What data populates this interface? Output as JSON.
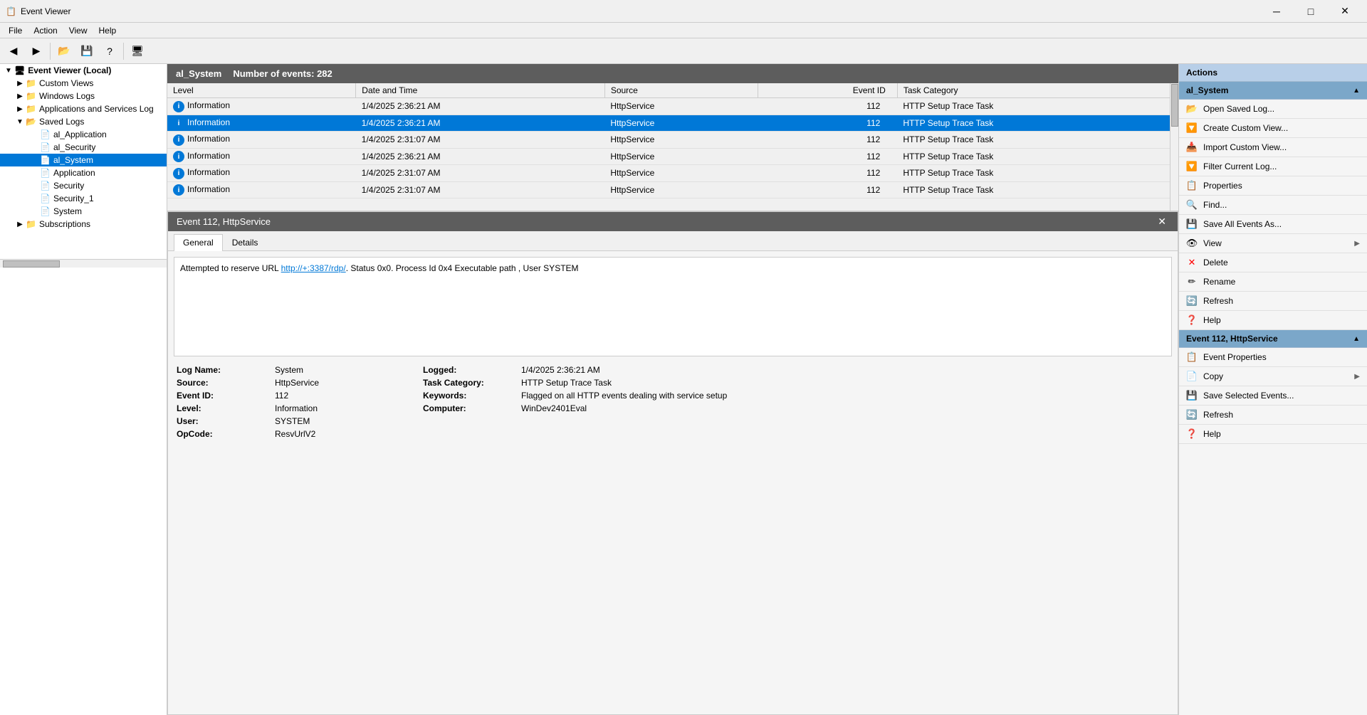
{
  "titleBar": {
    "title": "Event Viewer",
    "icon": "📋",
    "minimize": "─",
    "maximize": "□",
    "close": "✕"
  },
  "menuBar": {
    "items": [
      "File",
      "Action",
      "View",
      "Help"
    ]
  },
  "toolbar": {
    "back": "◀",
    "forward": "▶",
    "open": "📂",
    "save": "💾",
    "help": "?",
    "console": "🖥"
  },
  "tree": {
    "root": "Event Viewer (Local)",
    "items": [
      {
        "label": "Custom Views",
        "indent": 1,
        "expanded": false,
        "icon": "folder"
      },
      {
        "label": "Windows Logs",
        "indent": 1,
        "expanded": false,
        "icon": "folder"
      },
      {
        "label": "Applications and Services Log",
        "indent": 1,
        "expanded": false,
        "icon": "folder"
      },
      {
        "label": "Saved Logs",
        "indent": 1,
        "expanded": true,
        "icon": "folder"
      },
      {
        "label": "al_Application",
        "indent": 2,
        "icon": "log"
      },
      {
        "label": "al_Security",
        "indent": 2,
        "icon": "log"
      },
      {
        "label": "al_System",
        "indent": 2,
        "icon": "log",
        "selected": true
      },
      {
        "label": "Application",
        "indent": 2,
        "icon": "log"
      },
      {
        "label": "Security",
        "indent": 2,
        "icon": "log"
      },
      {
        "label": "Security_1",
        "indent": 2,
        "icon": "log"
      },
      {
        "label": "System",
        "indent": 2,
        "icon": "log"
      },
      {
        "label": "Subscriptions",
        "indent": 1,
        "expanded": false,
        "icon": "folder"
      }
    ]
  },
  "logHeader": {
    "name": "al_System",
    "eventCount": "Number of events: 282"
  },
  "tableColumns": [
    "Level",
    "Date and Time",
    "Source",
    "Event ID",
    "Task Category"
  ],
  "tableRows": [
    {
      "level": "Information",
      "dateTime": "1/4/2025 2:36:21 AM",
      "source": "HttpService",
      "eventId": "112",
      "taskCategory": "HTTP Setup Trace Task"
    },
    {
      "level": "Information",
      "dateTime": "1/4/2025 2:36:21 AM",
      "source": "HttpService",
      "eventId": "112",
      "taskCategory": "HTTP Setup Trace Task",
      "selected": true
    },
    {
      "level": "Information",
      "dateTime": "1/4/2025 2:31:07 AM",
      "source": "HttpService",
      "eventId": "112",
      "taskCategory": "HTTP Setup Trace Task"
    },
    {
      "level": "Information",
      "dateTime": "1/4/2025 2:36:21 AM",
      "source": "HttpService",
      "eventId": "112",
      "taskCategory": "HTTP Setup Trace Task"
    },
    {
      "level": "Information",
      "dateTime": "1/4/2025 2:31:07 AM",
      "source": "HttpService",
      "eventId": "112",
      "taskCategory": "HTTP Setup Trace Task"
    },
    {
      "level": "Information",
      "dateTime": "1/4/2025 2:31:07 AM",
      "source": "HttpService",
      "eventId": "112",
      "taskCategory": "HTTP Setup Trace Task"
    }
  ],
  "eventDetail": {
    "title": "Event 112, HttpService",
    "tabs": [
      "General",
      "Details"
    ],
    "activeTab": "General",
    "message": "Attempted to reserve URL http://+:3387/rdp/. Status 0x0. Process Id 0x4 Executable path , User SYSTEM",
    "linkText": "http://+:3387/rdp/",
    "logName": "System",
    "source": "HttpService",
    "eventId": "112",
    "level": "Information",
    "user": "SYSTEM",
    "opCode": "ResvUrlV2",
    "logged": "1/4/2025 2:36:21 AM",
    "taskCategory": "HTTP Setup Trace Task",
    "keywords": "Flagged on all HTTP events dealing with service setup",
    "computer": "WinDev2401Eval"
  },
  "actions": {
    "mainSection": {
      "title": "al_System",
      "items": [
        {
          "label": "Open Saved Log...",
          "icon": "📂"
        },
        {
          "label": "Create Custom View...",
          "icon": "🔽"
        },
        {
          "label": "Import Custom View...",
          "icon": "📥"
        },
        {
          "label": "Filter Current Log...",
          "icon": "🔽"
        },
        {
          "label": "Properties",
          "icon": "📋"
        },
        {
          "label": "Find...",
          "icon": "🔍"
        },
        {
          "label": "Save All Events As...",
          "icon": "💾"
        },
        {
          "label": "View",
          "icon": "👁",
          "hasSubmenu": true
        },
        {
          "label": "Delete",
          "icon": "✕",
          "iconColor": "red"
        },
        {
          "label": "Rename",
          "icon": "✏"
        },
        {
          "label": "Refresh",
          "icon": "🔄"
        },
        {
          "label": "Help",
          "icon": "❓"
        }
      ]
    },
    "eventSection": {
      "title": "Event 112, HttpService",
      "items": [
        {
          "label": "Event Properties",
          "icon": "📋"
        },
        {
          "label": "Copy",
          "icon": "📄",
          "hasSubmenu": true
        },
        {
          "label": "Save Selected Events...",
          "icon": "💾"
        },
        {
          "label": "Refresh",
          "icon": "🔄"
        },
        {
          "label": "Help",
          "icon": "❓"
        }
      ]
    }
  }
}
